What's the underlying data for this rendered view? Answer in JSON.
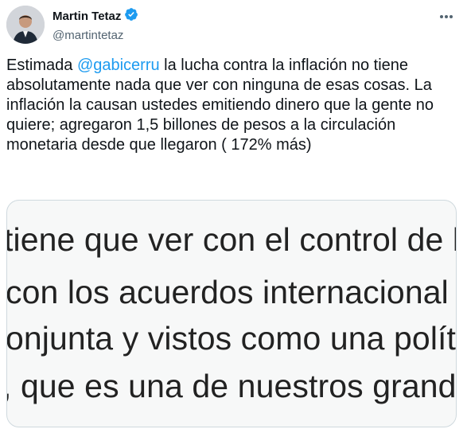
{
  "author": {
    "display_name": "Martin Tetaz",
    "handle": "@martintetaz",
    "verified": true,
    "avatar_icon": "profile-photo"
  },
  "tweet": {
    "text_before_mention": "Estimada ",
    "mention": "@gabicerru",
    "text_after_mention": " la lucha contra la inflación no tiene absolutamente nada que ver con ninguna de esas cosas. La inflación la causan ustedes emitiendo dinero que la gente no quiere; agregaron 1,5 billones de pesos a la circulación monetaria desde que llegaron ( 172% más)"
  },
  "media_image": {
    "lines": [
      "tiene que ver con el control de los p",
      "con los acuerdos internacional con",
      "onjunta y vistos como una política",
      ", que es una de nuestros grandes d"
    ]
  },
  "colors": {
    "link": "#1d9bf0",
    "verified_badge": "#1d9bf0",
    "secondary_text": "#536471"
  },
  "icons": {
    "more": "more-options-icon",
    "verified": "verified-badge-icon"
  }
}
